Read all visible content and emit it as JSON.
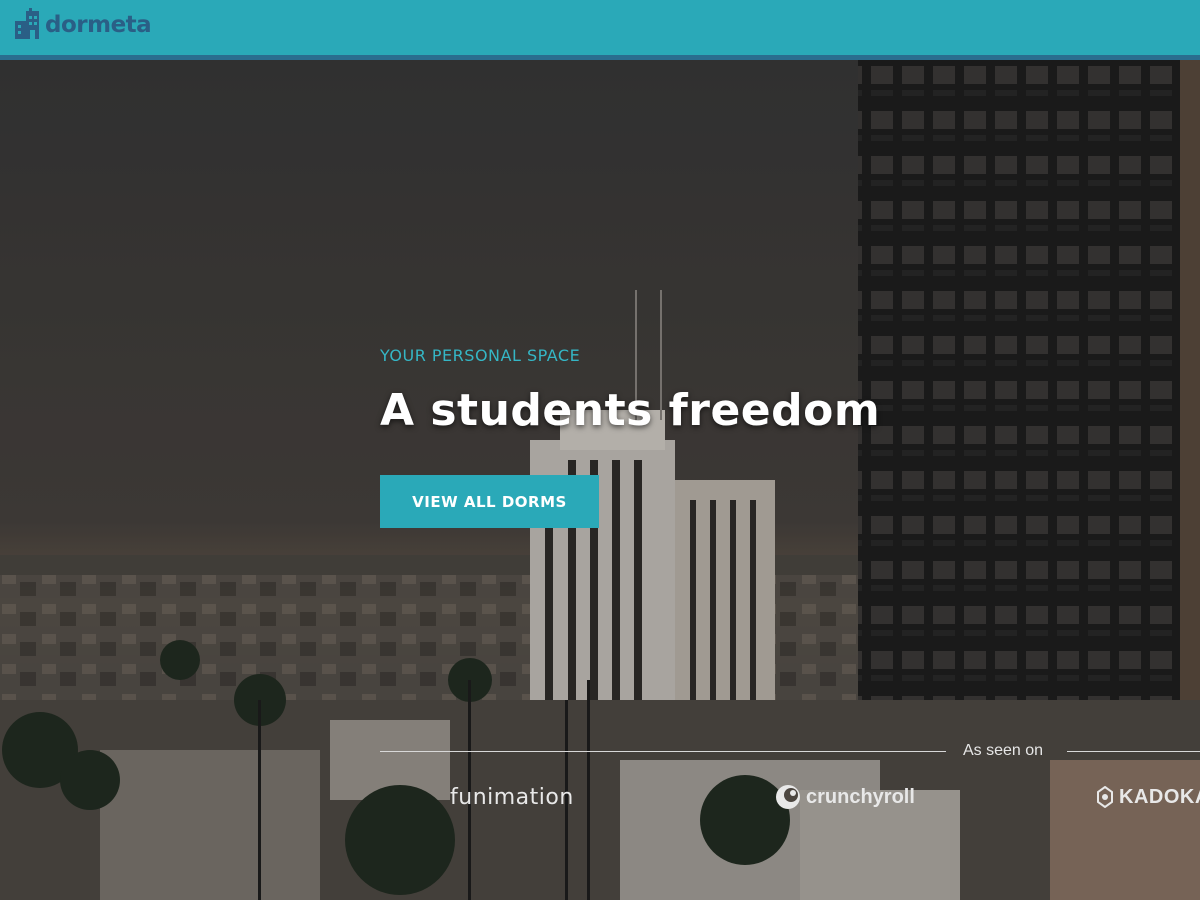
{
  "header": {
    "brand_name": "dormeta",
    "bar_color": "#2aa9b8",
    "accent_line_color": "#2a6d8f",
    "logo_icon": "house-building-icon"
  },
  "hero": {
    "eyebrow": "YOUR PERSONAL SPACE",
    "headline": "A students freedom",
    "cta_label": "VIEW ALL DORMS",
    "accent_color": "#2aa9b8",
    "background": "city-skyline-photo"
  },
  "press": {
    "label": "As seen on",
    "brands": [
      {
        "name": "funimation",
        "icon": "funimation-logo"
      },
      {
        "name": "crunchyroll",
        "icon": "crunchyroll-logo-icon"
      },
      {
        "name": "KADOKA",
        "icon": "kadokawa-logo-icon"
      }
    ]
  }
}
